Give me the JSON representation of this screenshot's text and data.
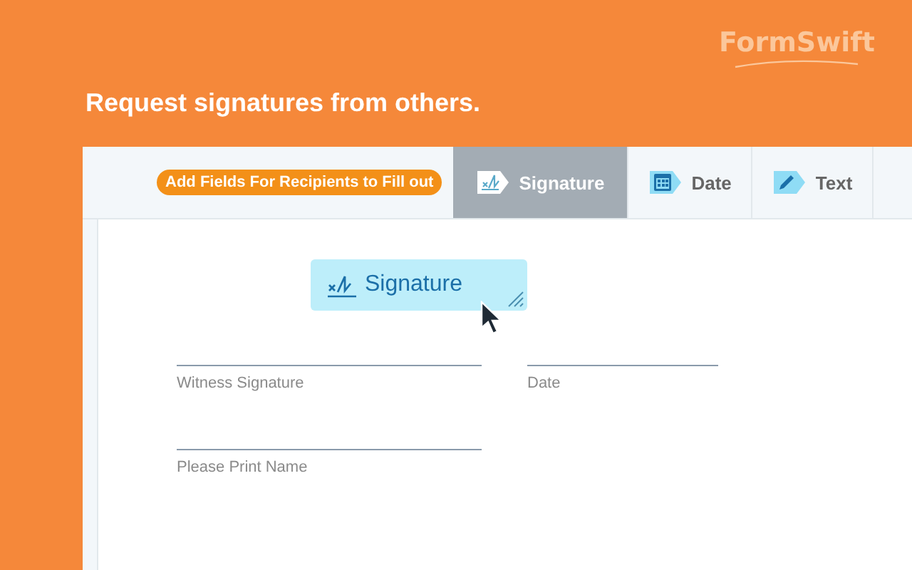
{
  "logo": "FormSwift",
  "headline": "Request signatures from others.",
  "toolbar": {
    "badge": "Add Fields For Recipients to Fill out",
    "tabs": [
      {
        "label": "Signature",
        "selected": true
      },
      {
        "label": "Date",
        "selected": false
      },
      {
        "label": "Text",
        "selected": false
      }
    ]
  },
  "document": {
    "placed_field": {
      "label": "Signature"
    },
    "fields": [
      {
        "label": "Witness Signature"
      },
      {
        "label": "Date"
      },
      {
        "label": "Please Print Name"
      }
    ]
  }
}
